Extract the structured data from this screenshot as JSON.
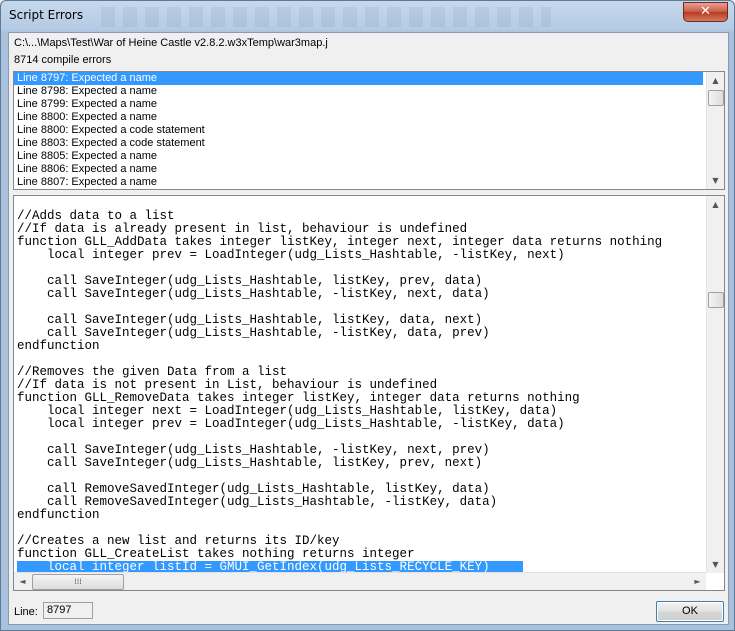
{
  "window": {
    "title": "Script Errors",
    "close_glyph": "✕"
  },
  "header": {
    "path": "C:\\...\\Maps\\Test\\War of Heine Castle v2.8.2.w3xTemp\\war3map.j",
    "error_count": "8714 compile errors"
  },
  "errors": [
    "Line 8797: Expected a name",
    "Line 8798: Expected a name",
    "Line 8799: Expected a name",
    "Line 8800: Expected a name",
    "Line 8800: Expected a code statement",
    "Line 8803: Expected a code statement",
    "Line 8805: Expected a name",
    "Line 8806: Expected a name",
    "Line 8807: Expected a name"
  ],
  "selected_error_index": 0,
  "code_lines": [
    "//Adds data to a list",
    "//If data is already present in list, behaviour is undefined",
    "function GLL_AddData takes integer listKey, integer next, integer data returns nothing",
    "    local integer prev = LoadInteger(udg_Lists_Hashtable, -listKey, next)",
    "",
    "    call SaveInteger(udg_Lists_Hashtable, listKey, prev, data)",
    "    call SaveInteger(udg_Lists_Hashtable, -listKey, next, data)",
    "",
    "    call SaveInteger(udg_Lists_Hashtable, listKey, data, next)",
    "    call SaveInteger(udg_Lists_Hashtable, -listKey, data, prev)",
    "endfunction",
    "",
    "//Removes the given Data from a list",
    "//If data is not present in List, behaviour is undefined",
    "function GLL_RemoveData takes integer listKey, integer data returns nothing",
    "    local integer next = LoadInteger(udg_Lists_Hashtable, listKey, data)",
    "    local integer prev = LoadInteger(udg_Lists_Hashtable, -listKey, data)",
    "",
    "    call SaveInteger(udg_Lists_Hashtable, -listKey, next, prev)",
    "    call SaveInteger(udg_Lists_Hashtable, listKey, prev, next)",
    "",
    "    call RemoveSavedInteger(udg_Lists_Hashtable, listKey, data)",
    "    call RemoveSavedInteger(udg_Lists_Hashtable, -listKey, data)",
    "endfunction",
    "",
    "//Creates a new list and returns its ID/key",
    "function GLL_CreateList takes nothing returns integer",
    "    local integer listId = GMUI_GetIndex(udg_Lists_RECYCLE_KEY)"
  ],
  "highlighted_code_line": 27,
  "scroll": {
    "up": "▲",
    "down": "▼",
    "left": "◄",
    "right": "►",
    "grip": "⁞⁞⁞"
  },
  "footer": {
    "line_label": "Line:",
    "line_value": "8797",
    "ok_label": "OK"
  },
  "colors": {
    "selection": "#3399ff"
  }
}
